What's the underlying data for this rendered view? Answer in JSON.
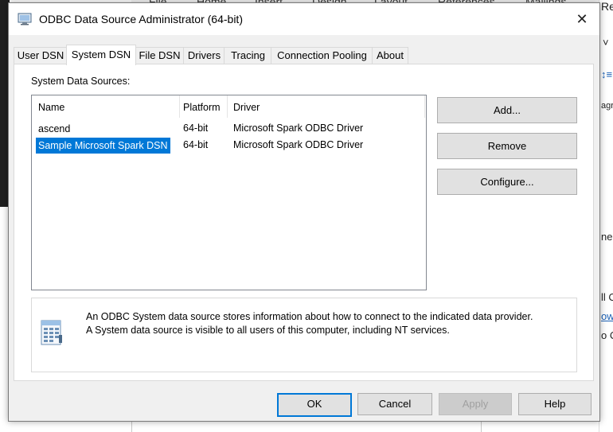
{
  "background": {
    "ribbon_items": [
      "File",
      "Home",
      "Insert",
      "Design",
      "Layout",
      "References",
      "Mailings"
    ],
    "right_fragments": [
      "Re",
      "˅",
      "↕≡",
      "agr",
      "nec",
      "ll C",
      "ow",
      "o C"
    ]
  },
  "dialog": {
    "title": "ODBC Data Source Administrator (64-bit)",
    "close_glyph": "✕",
    "tabs": [
      "User DSN",
      "System DSN",
      "File DSN",
      "Drivers",
      "Tracing",
      "Connection Pooling",
      "About"
    ],
    "active_tab": "System DSN",
    "section_label": "System Data Sources:",
    "columns": [
      "Name",
      "Platform",
      "Driver"
    ],
    "rows": [
      {
        "name": "ascend",
        "platform": "64-bit",
        "driver": "Microsoft Spark ODBC Driver",
        "selected": false
      },
      {
        "name": "Sample Microsoft Spark DSN",
        "platform": "64-bit",
        "driver": "Microsoft Spark ODBC Driver",
        "selected": true
      }
    ],
    "side_buttons": {
      "add": "Add...",
      "remove": "Remove",
      "configure": "Configure..."
    },
    "info": {
      "line1": "An ODBC System data source stores information about how to connect to the indicated data provider.",
      "line2": "A System data source is visible to all users of this computer, including NT services.",
      "icon": "database-icon"
    },
    "footer_buttons": {
      "ok": "OK",
      "cancel": "Cancel",
      "apply": "Apply",
      "help": "Help"
    },
    "colors": {
      "selection": "#0078d7",
      "default_button_border": "#0078d7",
      "dialog_bg": "#f0f0f0"
    }
  }
}
